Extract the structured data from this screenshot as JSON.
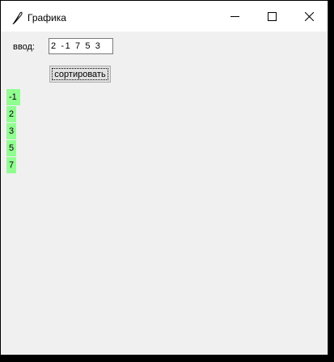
{
  "window": {
    "title": "Графика",
    "title_icon": "feather-icon",
    "controls": [
      "minimize-icon",
      "maximize-icon",
      "close-icon"
    ]
  },
  "form": {
    "input_label": "ввод:",
    "input_value": "2 -1 7 5 3",
    "sort_button": "сортировать"
  },
  "results": [
    "-1",
    "2",
    "3",
    "5",
    "7"
  ],
  "colors": {
    "result_highlight": "#90ff90",
    "window_bg": "#f0f0f0",
    "titlebar_bg": "#ffffff"
  }
}
